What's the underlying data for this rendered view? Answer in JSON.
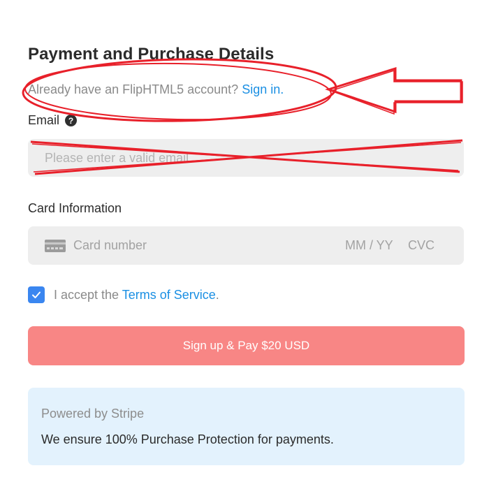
{
  "header": {
    "title": "Payment and Purchase Details"
  },
  "signin": {
    "prompt": "Already have an FlipHTML5 account?",
    "link_label": "Sign in",
    "trailing": "."
  },
  "email": {
    "label": "Email",
    "help_icon": "question-circle-icon",
    "help_glyph": "?",
    "placeholder": "Please enter a valid email",
    "value": ""
  },
  "card": {
    "label": "Card Information",
    "icon": "credit-card-icon",
    "number_placeholder": "Card number",
    "expiry_placeholder": "MM / YY",
    "cvc_placeholder": "CVC"
  },
  "terms": {
    "checked": true,
    "prefix": "I accept the",
    "link_label": "Terms of Service",
    "suffix": "."
  },
  "pay_button": {
    "label": "Sign up & Pay $20 USD"
  },
  "stripe": {
    "powered_by": "Powered by Stripe",
    "protection": "We ensure 100% Purchase Protection for payments."
  },
  "colors": {
    "link": "#1a8fe3",
    "pay_button": "#f88685",
    "checkbox": "#3a86f0",
    "stripe_box": "#e3f2fd",
    "annotation": "#e8202a"
  },
  "annotations": {
    "circle": "highlight-circle",
    "arrow": "pointing-arrow",
    "cross": "strike-through-cross"
  }
}
